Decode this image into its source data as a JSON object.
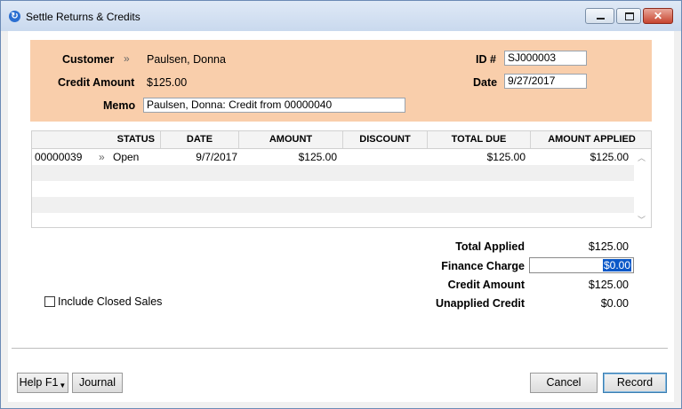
{
  "window": {
    "title": "Settle Returns & Credits",
    "close_glyph": "✕"
  },
  "header": {
    "customer_label": "Customer",
    "customer_value": "Paulsen, Donna",
    "credit_amount_label": "Credit Amount",
    "credit_amount_value": "$125.00",
    "memo_label": "Memo",
    "memo_value": "Paulsen, Donna:  Credit from 00000040",
    "id_label": "ID #",
    "id_value": "SJ000003",
    "date_label": "Date",
    "date_value": "9/27/2017"
  },
  "grid": {
    "columns": [
      "STATUS",
      "DATE",
      "AMOUNT",
      "DISCOUNT",
      "TOTAL DUE",
      "AMOUNT APPLIED"
    ],
    "rows": [
      {
        "id": "00000039",
        "status": "Open",
        "date": "9/7/2017",
        "amount": "$125.00",
        "discount": "",
        "total_due": "$125.00",
        "amount_applied": "$125.00"
      }
    ]
  },
  "summary": {
    "total_applied_label": "Total Applied",
    "total_applied_value": "$125.00",
    "finance_charge_label": "Finance Charge",
    "finance_charge_value": "$0.00",
    "credit_amount_label": "Credit Amount",
    "credit_amount_value": "$125.00",
    "unapplied_credit_label": "Unapplied Credit",
    "unapplied_credit_value": "$0.00"
  },
  "options": {
    "include_closed_sales_label": "Include Closed Sales"
  },
  "buttons": {
    "help": "Help F1",
    "journal": "Journal",
    "cancel": "Cancel",
    "record": "Record"
  },
  "colors": {
    "header_panel": "#f9ceab",
    "selection": "#0a58c8"
  },
  "icons": {
    "app": "refresh-icon",
    "chevron": "double-chevron-right-icon",
    "help_dropdown": "caret-down-icon"
  }
}
